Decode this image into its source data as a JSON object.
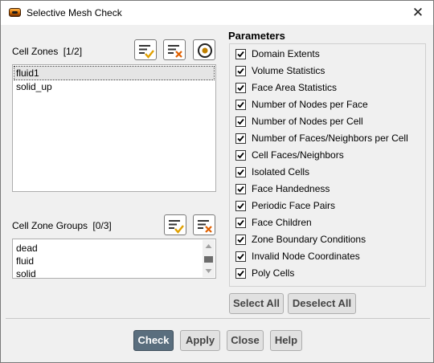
{
  "window": {
    "title": "Selective Mesh Check",
    "close_glyph": "✕"
  },
  "cell_zones": {
    "label": "Cell Zones",
    "count": "[1/2]",
    "items": [
      {
        "label": "fluid1",
        "selected": true
      },
      {
        "label": "solid_up",
        "selected": false
      }
    ]
  },
  "cell_zone_groups": {
    "label": "Cell Zone Groups",
    "count": "[0/3]",
    "items": [
      {
        "label": "dead"
      },
      {
        "label": "fluid"
      },
      {
        "label": "solid"
      }
    ]
  },
  "parameters": {
    "title": "Parameters",
    "items": [
      {
        "label": "Domain Extents",
        "checked": true
      },
      {
        "label": "Volume Statistics",
        "checked": true
      },
      {
        "label": "Face Area Statistics",
        "checked": true
      },
      {
        "label": "Number of Nodes per Face",
        "checked": true
      },
      {
        "label": "Number of Nodes per Cell",
        "checked": true
      },
      {
        "label": "Number of Faces/Neighbors per Cell",
        "checked": true
      },
      {
        "label": "Cell Faces/Neighbors",
        "checked": true
      },
      {
        "label": "Isolated Cells",
        "checked": true
      },
      {
        "label": "Face Handedness",
        "checked": true
      },
      {
        "label": "Periodic Face Pairs",
        "checked": true
      },
      {
        "label": "Face Children",
        "checked": true
      },
      {
        "label": "Zone Boundary Conditions",
        "checked": true
      },
      {
        "label": "Invalid Node Coordinates",
        "checked": true
      },
      {
        "label": "Poly Cells",
        "checked": true
      }
    ],
    "select_all": "Select All",
    "deselect_all": "Deselect All"
  },
  "footer": {
    "check": "Check",
    "apply": "Apply",
    "close": "Close",
    "help": "Help"
  },
  "colors": {
    "primary_button": "#5a6e7e",
    "checkmark_accent": "#e0a000",
    "deselect_accent": "#e06000"
  },
  "icons": {
    "app": "fluent-app-icon",
    "select_all_zones": "select-all-list-icon",
    "deselect_all_zones": "deselect-all-list-icon",
    "highlight": "target-icon"
  }
}
